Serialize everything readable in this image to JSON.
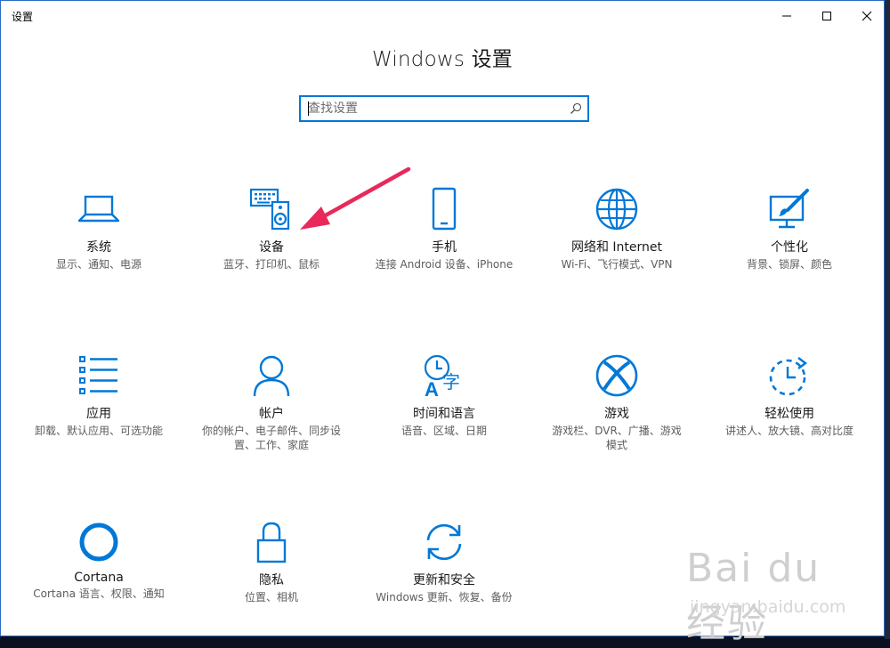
{
  "window": {
    "title": "设置",
    "heading": "Windows 设置",
    "controls": [
      "minimize-icon",
      "maximize-icon",
      "close-icon"
    ]
  },
  "search": {
    "placeholder": "查找设置",
    "value": ""
  },
  "accent_color": "#0078d7",
  "annotation_arrow_color": "#e8295a",
  "tiles": [
    {
      "icon": "laptop-icon",
      "name": "系统",
      "desc": "显示、通知、电源"
    },
    {
      "icon": "devices-icon",
      "name": "设备",
      "desc": "蓝牙、打印机、鼠标"
    },
    {
      "icon": "phone-icon",
      "name": "手机",
      "desc": "连接 Android 设备、iPhone"
    },
    {
      "icon": "globe-icon",
      "name": "网络和 Internet",
      "desc": "Wi-Fi、飞行模式、VPN"
    },
    {
      "icon": "personalization-icon",
      "name": "个性化",
      "desc": "背景、锁屏、颜色"
    },
    {
      "icon": "apps-list-icon",
      "name": "应用",
      "desc": "卸载、默认应用、可选功能"
    },
    {
      "icon": "person-icon",
      "name": "帐户",
      "desc": "你的帐户、电子邮件、同步设置、工作、家庭"
    },
    {
      "icon": "time-language-icon",
      "name": "时间和语言",
      "desc": "语音、区域、日期"
    },
    {
      "icon": "xbox-icon",
      "name": "游戏",
      "desc": "游戏栏、DVR、广播、游戏模式"
    },
    {
      "icon": "ease-of-access-icon",
      "name": "轻松使用",
      "desc": "讲述人、放大镜、高对比度"
    },
    {
      "icon": "cortana-icon",
      "name": "Cortana",
      "desc": "Cortana 语言、权限、通知"
    },
    {
      "icon": "lock-icon",
      "name": "隐私",
      "desc": "位置、相机"
    },
    {
      "icon": "sync-icon",
      "name": "更新和安全",
      "desc": "Windows 更新、恢复、备份"
    }
  ],
  "watermark": {
    "logo": "Bai du 经验",
    "url": "jingyan.baidu.com"
  }
}
